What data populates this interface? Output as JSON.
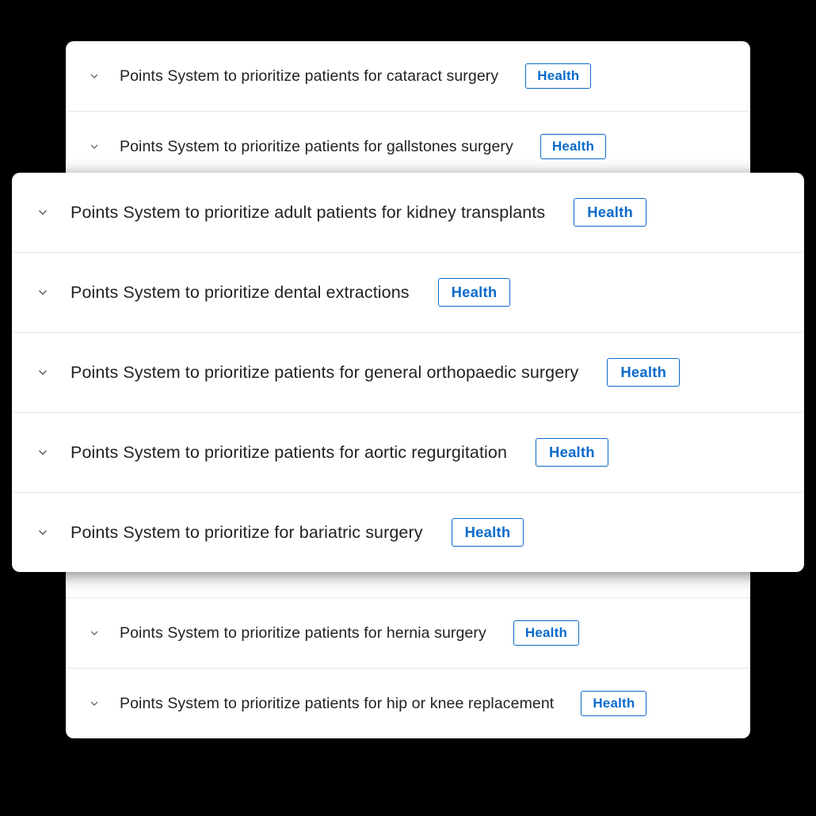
{
  "tag_label": "Health",
  "back_card": {
    "items": [
      {
        "title": "Points System to prioritize patients for cataract surgery"
      },
      {
        "title": "Points System to prioritize patients for gallstones surgery"
      },
      {
        "title": ""
      },
      {
        "title": ""
      },
      {
        "title": ""
      },
      {
        "title": ""
      },
      {
        "title": ""
      },
      {
        "title": "Points System to prioritize patients for hernia surgery"
      },
      {
        "title": "Points System to prioritize patients for hip or knee replacement"
      }
    ]
  },
  "front_card": {
    "items": [
      {
        "title": "Points System to prioritize adult patients for kidney transplants"
      },
      {
        "title": "Points System to prioritize dental extractions"
      },
      {
        "title": "Points System to prioritize patients for general orthopaedic surgery"
      },
      {
        "title": "Points System to prioritize patients for aortic regurgitation"
      },
      {
        "title": "Points System to prioritize for bariatric surgery"
      }
    ]
  }
}
